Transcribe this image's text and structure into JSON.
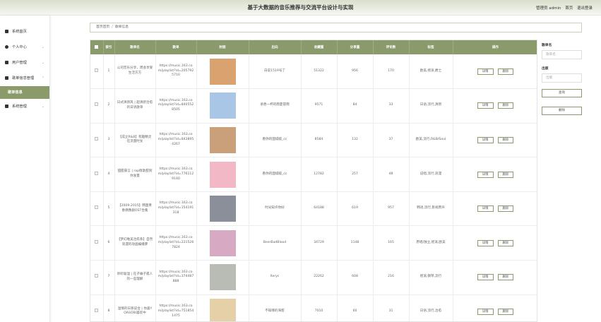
{
  "app": {
    "title": "基于大数据的音乐推荐与交流平台设计与实现"
  },
  "topright": {
    "admin_label": "管理员 admin",
    "home_label": "首页",
    "logout_label": "退出登录"
  },
  "sidebar": {
    "items": [
      {
        "label": "系统首页",
        "icon": "home-icon"
      },
      {
        "label": "个人中心",
        "icon": "user-icon"
      },
      {
        "label": "用户管理",
        "icon": "users-icon"
      },
      {
        "label": "歌单信息管理",
        "icon": "playlist-icon"
      },
      {
        "label": "系统管理",
        "icon": "settings-icon"
      }
    ],
    "active_sub": "歌单信息"
  },
  "breadcrumb": {
    "home": "首页首页",
    "sep": "/",
    "current": "歌单信息"
  },
  "table": {
    "headers": [
      "",
      "索引",
      "歌单名",
      "歌单",
      "封面",
      "出向",
      "收藏量",
      "分享量",
      "评论数",
      "标签",
      "操作"
    ],
    "detail_label": "详情",
    "delete_label": "删除",
    "rows": [
      {
        "idx": "1",
        "name": "公司音乐分享，周会享受生活方方",
        "url": "https://music.163.com/playlist?id=2057925710",
        "cover": "#d9a26e",
        "user": "白说1519号了",
        "plays": "51322",
        "shares": "956",
        "comments": "170",
        "tags": "欧美,摇滚,爵士"
      },
      {
        "idx": "2",
        "name": "日式清新风 | 超清新治愈的日语歌单",
        "url": "https://music.163.com/playlist?id=8405528505",
        "cover": "#a9c6e6",
        "user": "承善一杯的雨夏冒雨",
        "plays": "9571",
        "shares": "84",
        "comments": "33",
        "tags": "日语,流行,清新"
      },
      {
        "idx": "3",
        "name": "【成立R&B】有趣精灵在流量时女",
        "url": "https://music.163.com/playlist?id=8438954267",
        "cover": "#c9a07a",
        "user": "看你的国城级_cc",
        "plays": "8584",
        "shares": "132",
        "comments": "37",
        "tags": "欧美,流行,R&B/Soul"
      },
      {
        "idx": "4",
        "name": "甜甜豪言 | rap情歌甜到你发量",
        "url": "https://music.163.com/playlist?id=7761129140",
        "cover": "#f2b8c6",
        "user": "看你的国城级_cc",
        "plays": "12782",
        "shares": "257",
        "comments": "48",
        "tags": "说唱,流行,浪漫"
      },
      {
        "idx": "5",
        "name": "【2009-2015】韩国青春偶像剧OST合集",
        "url": "https://music.163.com/playlist?id=154191318",
        "cover": "#8a8f99",
        "user": "时光知许你好",
        "plays": "64188",
        "shares": "619",
        "comments": "957",
        "tags": "韩语,流行,影视原声"
      },
      {
        "idx": "6",
        "name": "【梦幻唯美治愈系】自然浪漫的动画编播萝",
        "url": "https://music.163.com/playlist?id=2215267824",
        "cover": "#d8a9c2",
        "user": "BeerBadBlood",
        "plays": "34729",
        "shares": "1148",
        "comments": "165",
        "tags": "原唱/独立,摇滚,欧美"
      },
      {
        "idx": "7",
        "name": "聆听聪温 | 在子痛子孤人的一些理解",
        "url": "https://music.163.com/playlist?id=374487888",
        "cover": "#b8bcb4",
        "user": "Xeryc",
        "plays": "22262",
        "shares": "608",
        "comments": "216",
        "tags": "摇滚,钢琴,流行"
      },
      {
        "idx": "8",
        "name": "温情的日系说合 | 你喜YOASOBI喜欢中",
        "url": "https://music.163.com/playlist?id=7518541475",
        "cover": "#e6d0a8",
        "user": "不知哪的海客",
        "plays": "7010",
        "shares": "60",
        "comments": "31",
        "tags": "日语,流行,治愈"
      }
    ]
  },
  "search": {
    "name_label": "歌单名",
    "name_placeholder": "歌单名",
    "user_label": "出版",
    "user_placeholder": "出版",
    "query_button": "查询",
    "delete_button": "删除"
  },
  "colors": {
    "accent": "#8a9a6b",
    "topbar": "#e2e8d6"
  }
}
